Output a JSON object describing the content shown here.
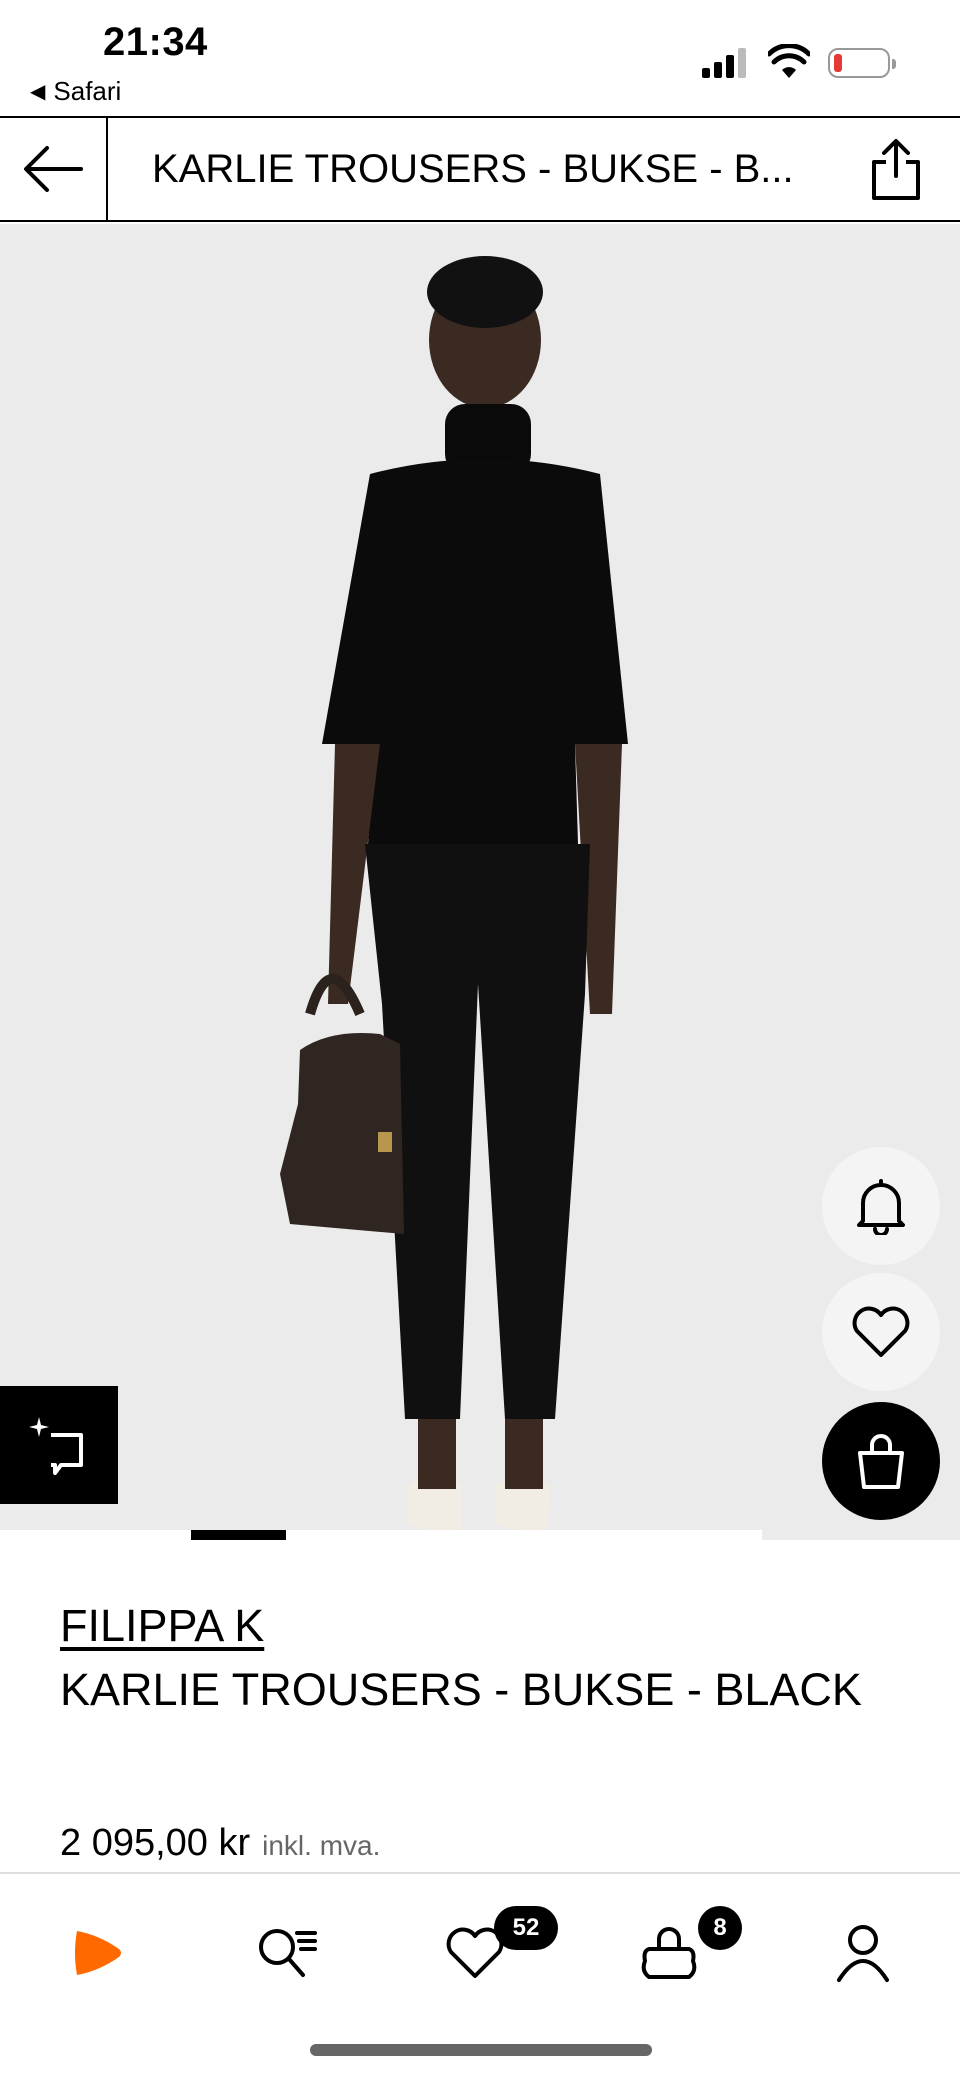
{
  "status_bar": {
    "time": "21:34",
    "back_app": "Safari",
    "back_glyph": "◀"
  },
  "header": {
    "title": "KARLIE TROUSERS - BUKSE - B..."
  },
  "product": {
    "brand": "FILIPPA K",
    "name": "KARLIE TROUSERS - BUKSE - BLACK",
    "price": "2 095,00 kr",
    "price_note": "inkl. mva."
  },
  "gallery": {
    "active_index": 1
  },
  "bottom_nav": {
    "wishlist_count": "52",
    "cart_count": "8"
  },
  "colors": {
    "brand_orange": "#ff6900",
    "image_bg": "#ebebeb",
    "battery_low": "#e53935"
  },
  "icons": [
    "back-arrow-icon",
    "share-icon",
    "bell-icon",
    "heart-icon",
    "shopping-bag-icon",
    "sketch-icon",
    "zalando-logo-icon",
    "search-icon",
    "wishlist-icon",
    "cart-icon",
    "profile-icon"
  ]
}
